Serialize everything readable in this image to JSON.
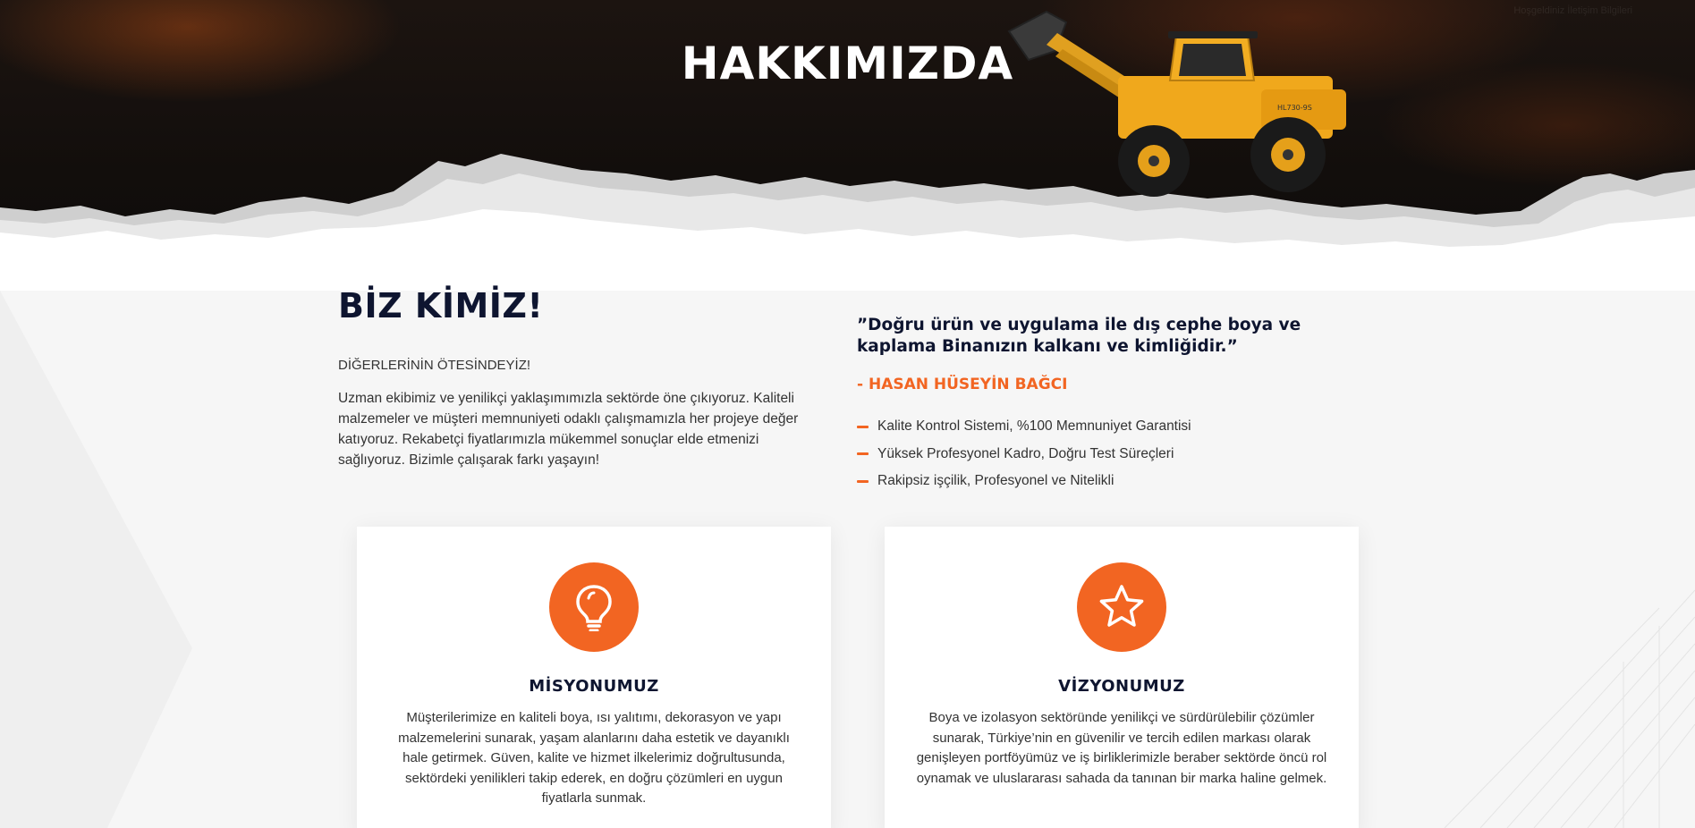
{
  "hero": {
    "title": "HAKKIMIZDA",
    "faint_text": "Hoşgeldiniz İletişim Bilgileri",
    "machine_label": "HL730-9S"
  },
  "about": {
    "heading": "BİZ KİMİZ!",
    "subtitle": "DİĞERLERİNİN ÖTESİNDEYİZ!",
    "text": "Uzman ekibimiz ve yenilikçi yaklaşımımızla sektörde öne çıkıyoruz. Kaliteli malzemeler ve müşteri memnuniyeti odaklı çalışmamızla her projeye değer katıyoruz. Rekabetçi fiyatlarımızla mükemmel sonuçlar elde etmenizi sağlıyoruz. Bizimle çalışarak farkı yaşayın!"
  },
  "quote": {
    "text": "”Doğru ürün ve uygulama ile dış cephe boya ve kaplama Binanızın kalkanı ve kimliğidir.”",
    "author": "- HASAN HÜSEYİN BAĞCI",
    "features": [
      "Kalite Kontrol Sistemi, %100 Memnuniyet Garantisi",
      "Yüksek Profesyonel Kadro, Doğru Test Süreçleri",
      "Rakipsiz işçilik, Profesyonel ve Nitelikli"
    ]
  },
  "cards": {
    "mission": {
      "icon": "lightbulb-icon",
      "title": "MİSYONUMUZ",
      "text": "Müşterilerimize en kaliteli boya, ısı yalıtımı, dekorasyon ve yapı malzemelerini sunarak, yaşam alanlarını daha estetik ve dayanıklı hale getirmek. Güven, kalite ve hizmet ilkelerimiz doğrultusunda, sektördeki yenilikleri takip ederek, en doğru çözümleri en uygun fiyatlarla sunmak."
    },
    "vision": {
      "icon": "star-icon",
      "title": "VİZYONUMUZ",
      "text": "Boya ve izolasyon sektöründe yenilikçi ve sürdürülebilir çözümler sunarak, Türkiye’nin en güvenilir ve tercih edilen markası olarak genişleyen portföyümüz ve iş birliklerimizle beraber sektörde öncü rol oynamak ve uluslararası sahada da tanınan bir marka haline gelmek."
    }
  },
  "colors": {
    "accent": "#f26522",
    "heading": "#0e1530",
    "hero_dark": "#120e0c"
  }
}
